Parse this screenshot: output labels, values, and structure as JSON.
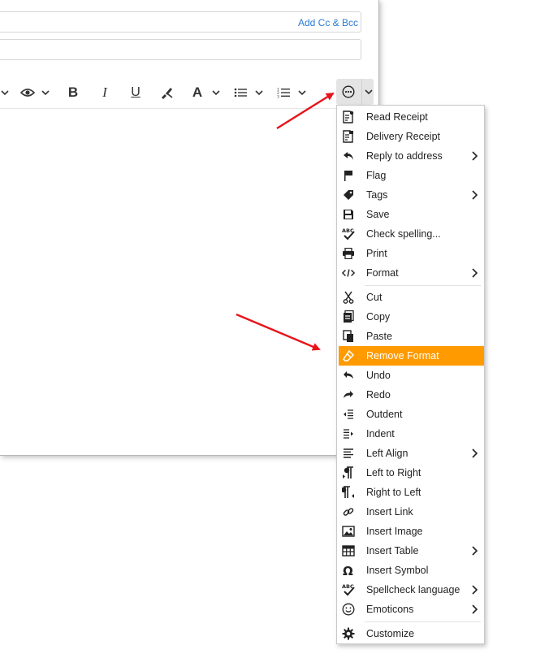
{
  "compose": {
    "add_cc_bcc": "Add Cc & Bcc"
  },
  "toolbar": {
    "items": [
      "view-icon",
      "bold-icon",
      "italic-icon",
      "underline-icon",
      "paint-brush-icon",
      "font-color-icon",
      "bullet-list-icon",
      "numbered-list-icon",
      "more-options-icon"
    ]
  },
  "menu": {
    "highlight_color": "#ff9b00",
    "items": [
      {
        "label": "Read Receipt",
        "icon": "read-receipt-icon",
        "submenu": false
      },
      {
        "label": "Delivery Receipt",
        "icon": "delivery-receipt-icon",
        "submenu": false
      },
      {
        "label": "Reply to address",
        "icon": "reply-icon",
        "submenu": true
      },
      {
        "label": "Flag",
        "icon": "flag-icon",
        "submenu": false
      },
      {
        "label": "Tags",
        "icon": "tag-icon",
        "submenu": true
      },
      {
        "label": "Save",
        "icon": "save-icon",
        "submenu": false
      },
      {
        "label": "Check spelling...",
        "icon": "spellcheck-icon",
        "submenu": false
      },
      {
        "label": "Print",
        "icon": "printer-icon",
        "submenu": false
      },
      {
        "label": "Format",
        "icon": "code-icon",
        "submenu": true
      },
      {
        "label": "Cut",
        "icon": "scissors-icon",
        "submenu": false
      },
      {
        "label": "Copy",
        "icon": "copy-icon",
        "submenu": false
      },
      {
        "label": "Paste",
        "icon": "paste-icon",
        "submenu": false
      },
      {
        "label": "Remove Format",
        "icon": "eraser-icon",
        "submenu": false,
        "active": true
      },
      {
        "label": "Undo",
        "icon": "undo-icon",
        "submenu": false
      },
      {
        "label": "Redo",
        "icon": "redo-icon",
        "submenu": false
      },
      {
        "label": "Outdent",
        "icon": "outdent-icon",
        "submenu": false
      },
      {
        "label": "Indent",
        "icon": "indent-icon",
        "submenu": false
      },
      {
        "label": "Left Align",
        "icon": "align-left-icon",
        "submenu": true
      },
      {
        "label": "Left to Right",
        "icon": "ltr-icon",
        "submenu": false
      },
      {
        "label": "Right to Left",
        "icon": "rtl-icon",
        "submenu": false
      },
      {
        "label": "Insert Link",
        "icon": "link-icon",
        "submenu": false
      },
      {
        "label": "Insert Image",
        "icon": "image-icon",
        "submenu": false
      },
      {
        "label": "Insert Table",
        "icon": "table-icon",
        "submenu": true
      },
      {
        "label": "Insert Symbol",
        "icon": "omega-icon",
        "submenu": false
      },
      {
        "label": "Spellcheck language",
        "icon": "spellcheck-language-icon",
        "submenu": true
      },
      {
        "label": "Emoticons",
        "icon": "smiley-icon",
        "submenu": true
      },
      {
        "label": "Customize",
        "icon": "gear-icon",
        "submenu": false
      }
    ]
  },
  "annotations": {
    "arrow_color": "#e8141b"
  }
}
